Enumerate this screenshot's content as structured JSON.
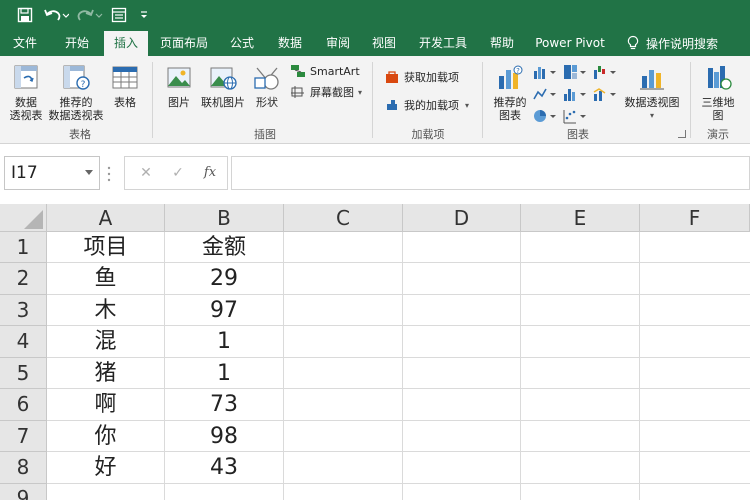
{
  "quick_access": {
    "save_icon": "save-icon",
    "undo_icon": "undo-icon",
    "redo_icon": "redo-icon",
    "form_icon": "form-icon",
    "customize_icon": "customize-icon"
  },
  "tabs": [
    {
      "label": "文件",
      "active": false
    },
    {
      "label": "开始",
      "active": false
    },
    {
      "label": "插入",
      "active": true
    },
    {
      "label": "页面布局",
      "active": false
    },
    {
      "label": "公式",
      "active": false
    },
    {
      "label": "数据",
      "active": false
    },
    {
      "label": "审阅",
      "active": false
    },
    {
      "label": "视图",
      "active": false
    },
    {
      "label": "开发工具",
      "active": false
    },
    {
      "label": "帮助",
      "active": false
    },
    {
      "label": "Power Pivot",
      "active": false
    }
  ],
  "tell_me": "操作说明搜索",
  "ribbon": {
    "pivot_table": [
      "数据",
      "透视表"
    ],
    "recommended_pivot": [
      "推荐的",
      "数据透视表"
    ],
    "table": "表格",
    "tables_group": "表格",
    "picture": "图片",
    "online_picture": "联机图片",
    "shapes": "形状",
    "smartart": "SmartArt",
    "screenshot": "屏幕截图",
    "illustrations_group": "插图",
    "get_addins": "获取加载项",
    "my_addins": "我的加载项",
    "addins_group": "加载项",
    "recommended_charts": [
      "推荐的",
      "图表"
    ],
    "pivot_chart": "数据透视图",
    "charts_group": "图表",
    "map_3d": [
      "三维地",
      "图"
    ],
    "tours_group": "演示"
  },
  "formula_bar": {
    "name_box": "I17",
    "cancel": "✕",
    "enter": "✓",
    "fx": "fx",
    "value": ""
  },
  "sheet": {
    "columns": [
      "A",
      "B",
      "C",
      "D",
      "E",
      "F"
    ],
    "rows": [
      "1",
      "2",
      "3",
      "4",
      "5",
      "6",
      "7",
      "8",
      "9"
    ],
    "header": [
      "项目",
      "金额"
    ],
    "data": [
      [
        "鱼",
        "29"
      ],
      [
        "木",
        "97"
      ],
      [
        "混",
        "1"
      ],
      [
        "猪",
        "1"
      ],
      [
        "啊",
        "73"
      ],
      [
        "你",
        "98"
      ],
      [
        "好",
        "43"
      ]
    ]
  },
  "colors": {
    "brand": "#217346",
    "ribbon_bg": "#f3f3f3",
    "header_bg": "#e6e6e6",
    "gridline": "#dadada"
  }
}
